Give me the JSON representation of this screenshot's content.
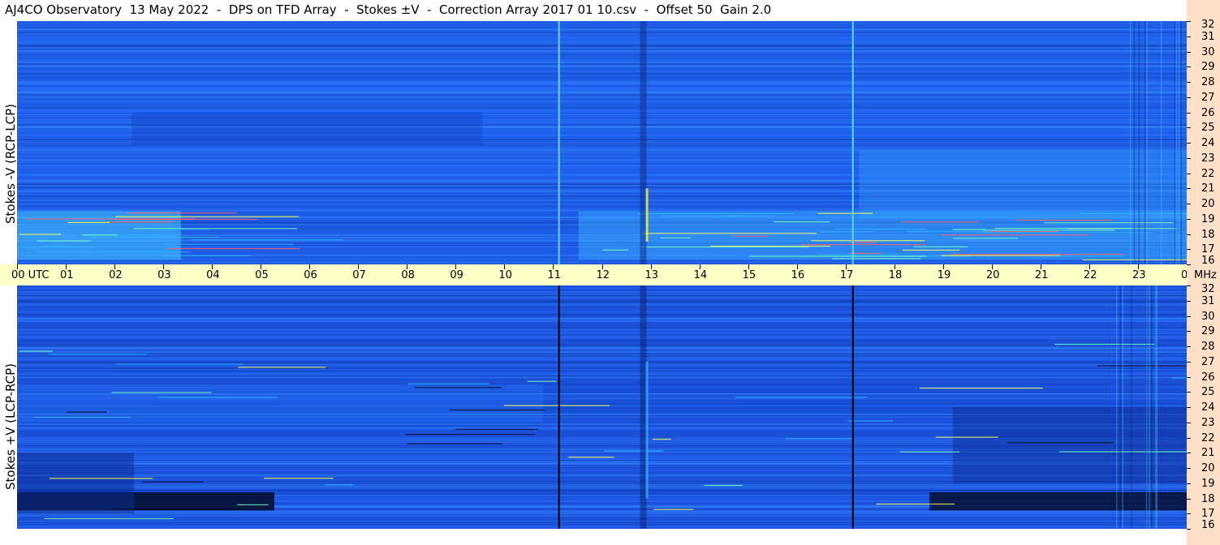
{
  "title": "AJ4CO Observatory  13 May 2022  -  DPS on TFD Array  -  Stokes ±V  -  Correction Array 2017 01 10.csv  -  Offset 50  Gain 2.0",
  "top_panel_label": "Stokes -V (RCP-LCP)",
  "bottom_panel_label": "Stokes +V (LCP-RCP)",
  "chart_data": {
    "type": "heatmap",
    "x_tick_labels": [
      "00 UTC",
      "01",
      "02",
      "03",
      "04",
      "05",
      "06",
      "07",
      "08",
      "09",
      "10",
      "11",
      "12",
      "13",
      "14",
      "15",
      "16",
      "17",
      "18",
      "19",
      "20",
      "21",
      "22",
      "23",
      "00"
    ],
    "y_tick_labels": [
      "32",
      "31",
      "30",
      "29",
      "28",
      "27",
      "26",
      "25",
      "24",
      "23",
      "22",
      "21",
      "20",
      "19",
      "18",
      "17",
      "16"
    ],
    "y_unit": "MHz",
    "x_range_utc_hours": [
      0,
      24
    ],
    "y_range_mhz": [
      16,
      32
    ],
    "colormap": [
      "#0a0a3c",
      "#1040c0",
      "#1e78ff",
      "#30b4ff",
      "#78ffc0",
      "#ffff50",
      "#ff6060"
    ],
    "panels": [
      {
        "name": "Stokes -V (RCP-LCP)",
        "background_color": "#1e5ce6",
        "bright_band_mhz": [
          16.3,
          19.5
        ],
        "bright_color": "#33ccff",
        "vertical_lines_utc": [
          11.12,
          17.15
        ],
        "vertical_line_color": "#5ad8ff",
        "emission_columns_utc": [
          12.85
        ]
      },
      {
        "name": "Stokes +V (LCP-RCP)",
        "background_color": "#1a4fd8",
        "dark_band_mhz": [
          17.2,
          18.4
        ],
        "dark_color": "#050a28",
        "vertical_lines_utc": [
          11.12,
          17.15
        ],
        "vertical_line_color": "#000000",
        "emission_columns_utc": [
          12.85
        ]
      }
    ]
  }
}
